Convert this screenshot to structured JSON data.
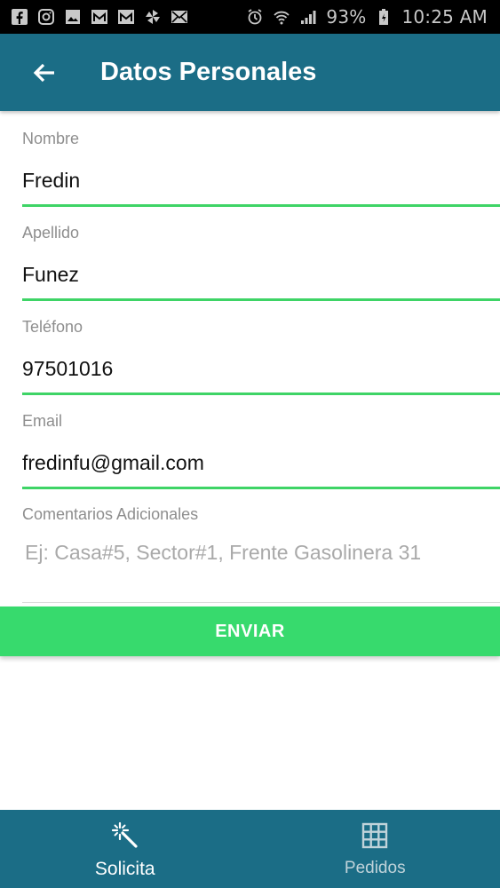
{
  "status_bar": {
    "battery": "93%",
    "time": "10:25 AM",
    "left_icons": [
      "facebook-icon",
      "instagram-icon",
      "image-icon",
      "gmail-icon",
      "gmail-icon",
      "pinwheel-icon",
      "mail-icon"
    ],
    "right_icons": [
      "alarm-icon",
      "wifi-icon",
      "signal-icon",
      "battery-icon"
    ]
  },
  "app_bar": {
    "title": "Datos Personales",
    "back_icon": "arrow-back-icon",
    "color": "#1b6d86"
  },
  "form": {
    "nombre": {
      "label": "Nombre",
      "value": "Fredin"
    },
    "apellido": {
      "label": "Apellido",
      "value": "Funez"
    },
    "telefono": {
      "label": "Teléfono",
      "value": "97501016"
    },
    "email": {
      "label": "Email",
      "value": "fredinfu@gmail.com"
    },
    "comentarios": {
      "label": "Comentarios Adicionales",
      "value": "",
      "placeholder": "Ej: Casa#5, Sector#1, Frente Gasolinera 31"
    },
    "accent_color": "#3ed466"
  },
  "submit": {
    "label": "ENVIAR",
    "color": "#37da6d"
  },
  "bottom_nav": {
    "items": [
      {
        "label": "Solicita",
        "icon": "magic-wand-icon",
        "active": true
      },
      {
        "label": "Pedidos",
        "icon": "grid-icon",
        "active": false
      }
    ]
  }
}
